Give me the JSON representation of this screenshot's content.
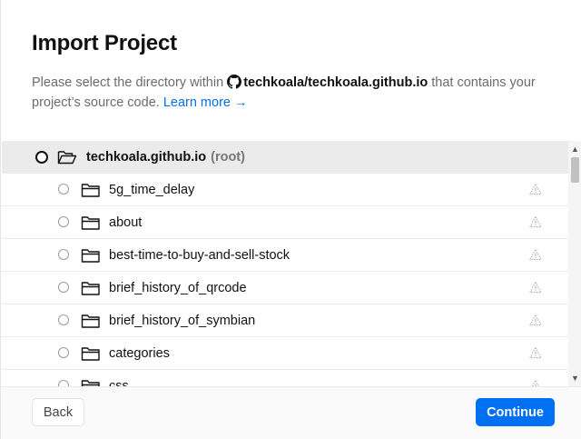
{
  "dialog": {
    "title": "Import Project",
    "description_before": "Please select the directory within",
    "repo": "techkoala/techkoala.github.io",
    "description_after": "that contains your project’s source code.",
    "learn_more": "Learn more →"
  },
  "root": {
    "name": "techkoala.github.io",
    "suffix": "(root)",
    "selected": true
  },
  "folders": [
    {
      "name": "5g_time_delay"
    },
    {
      "name": "about"
    },
    {
      "name": "best-time-to-buy-and-sell-stock"
    },
    {
      "name": "brief_history_of_qrcode"
    },
    {
      "name": "brief_history_of_symbian"
    },
    {
      "name": "categories"
    },
    {
      "name": "css"
    }
  ],
  "icons": {
    "repo": "github-icon",
    "folder": "folder-icon",
    "root_folder": "folder-open-icon",
    "row_status": "warning-triangle-icon"
  },
  "footer": {
    "back_label": "Back",
    "continue_label": "Continue"
  },
  "colors": {
    "accent": "#0070f3",
    "selected_row": "#ebebeb"
  }
}
